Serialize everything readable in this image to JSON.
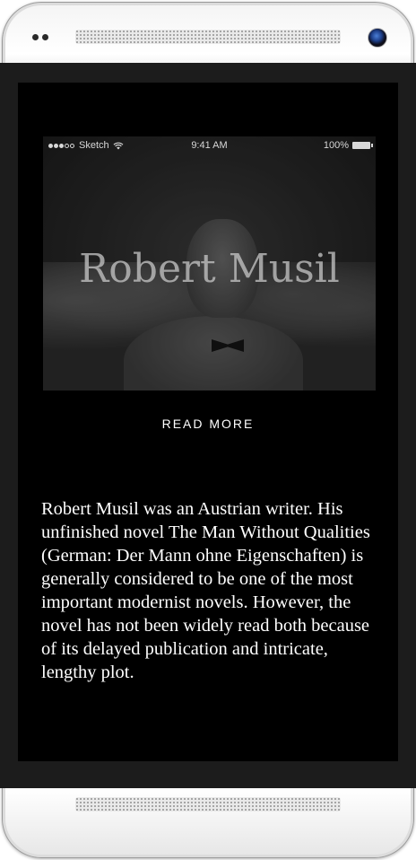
{
  "statusbar": {
    "carrier": "Sketch",
    "time": "9:41 AM",
    "battery": "100%",
    "signal_bars_filled": 3,
    "signal_bars_total": 5
  },
  "hero": {
    "title": "Robert Musil"
  },
  "read_more_label": "READ MORE",
  "bio_text": "Robert Musil was an Austrian writer. His unfinished novel The Man Without Qualities (German: Der Mann ohne Eigenschaften) is generally considered to be one of the most important modernist novels. However, the novel has not been widely read both because of its delayed publication and intricate, lengthy plot.",
  "colors": {
    "screen_background": "#000000",
    "text": "#ffffff",
    "device_frame": "#f2f2f2"
  }
}
